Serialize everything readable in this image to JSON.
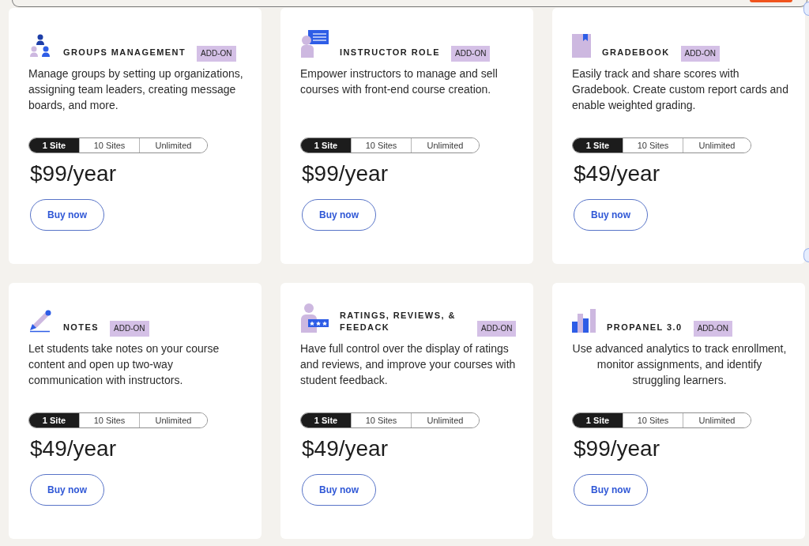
{
  "products": [
    {
      "kind": "groups",
      "title": "GROUPS MANAGEMENT",
      "badge": "ADD-ON",
      "description": "Manage groups by setting up organizations, assigning team leaders, creating message boards, and more.",
      "centered_description": false,
      "options": [
        {
          "label": "1 Site",
          "selected": true
        },
        {
          "label": "10 Sites",
          "selected": false
        },
        {
          "label": "Unlimited",
          "selected": false
        }
      ],
      "price": "$99/year",
      "button": "Buy now"
    },
    {
      "kind": "instructor",
      "title": "INSTRUCTOR ROLE",
      "badge": "ADD-ON",
      "description": "Empower instructors to manage and sell courses with front-end course creation.",
      "centered_description": false,
      "options": [
        {
          "label": "1 Site",
          "selected": true
        },
        {
          "label": "10 Sites",
          "selected": false
        },
        {
          "label": "Unlimited",
          "selected": false
        }
      ],
      "price": "$99/year",
      "button": "Buy now"
    },
    {
      "kind": "gradebook",
      "title": "GRADEBOOK",
      "badge": "ADD-ON",
      "description": "Easily track and share scores with Gradebook. Create custom report cards and enable weighted grading.",
      "centered_description": false,
      "options": [
        {
          "label": "1 Site",
          "selected": true
        },
        {
          "label": "10 Sites",
          "selected": false
        },
        {
          "label": "Unlimited",
          "selected": false
        }
      ],
      "price": "$49/year",
      "button": "Buy now"
    },
    {
      "kind": "notes",
      "title": "NOTES",
      "badge": "ADD-ON",
      "description": "Let students take notes on your course content and open up two-way communication with instructors.",
      "centered_description": false,
      "options": [
        {
          "label": "1 Site",
          "selected": true
        },
        {
          "label": "10 Sites",
          "selected": false
        },
        {
          "label": "Unlimited",
          "selected": false
        }
      ],
      "price": "$49/year",
      "button": "Buy now"
    },
    {
      "kind": "ratings",
      "title": "RATINGS, REVIEWS, & FEEDACK",
      "badge": "ADD-ON",
      "description": "Have full control over the display of ratings and reviews, and improve your courses with student feedback.",
      "centered_description": false,
      "options": [
        {
          "label": "1 Site",
          "selected": true
        },
        {
          "label": "10 Sites",
          "selected": false
        },
        {
          "label": "Unlimited",
          "selected": false
        }
      ],
      "price": "$49/year",
      "button": "Buy now"
    },
    {
      "kind": "analytics",
      "title": "PROPANEL 3.0",
      "badge": "ADD-ON",
      "description": "Use advanced analytics to track enrollment, monitor assignments, and identify struggling learners.",
      "centered_description": true,
      "options": [
        {
          "label": "1 Site",
          "selected": true
        },
        {
          "label": "10 Sites",
          "selected": false
        },
        {
          "label": "Unlimited",
          "selected": false
        }
      ],
      "price": "$99/year",
      "button": "Buy now"
    }
  ]
}
